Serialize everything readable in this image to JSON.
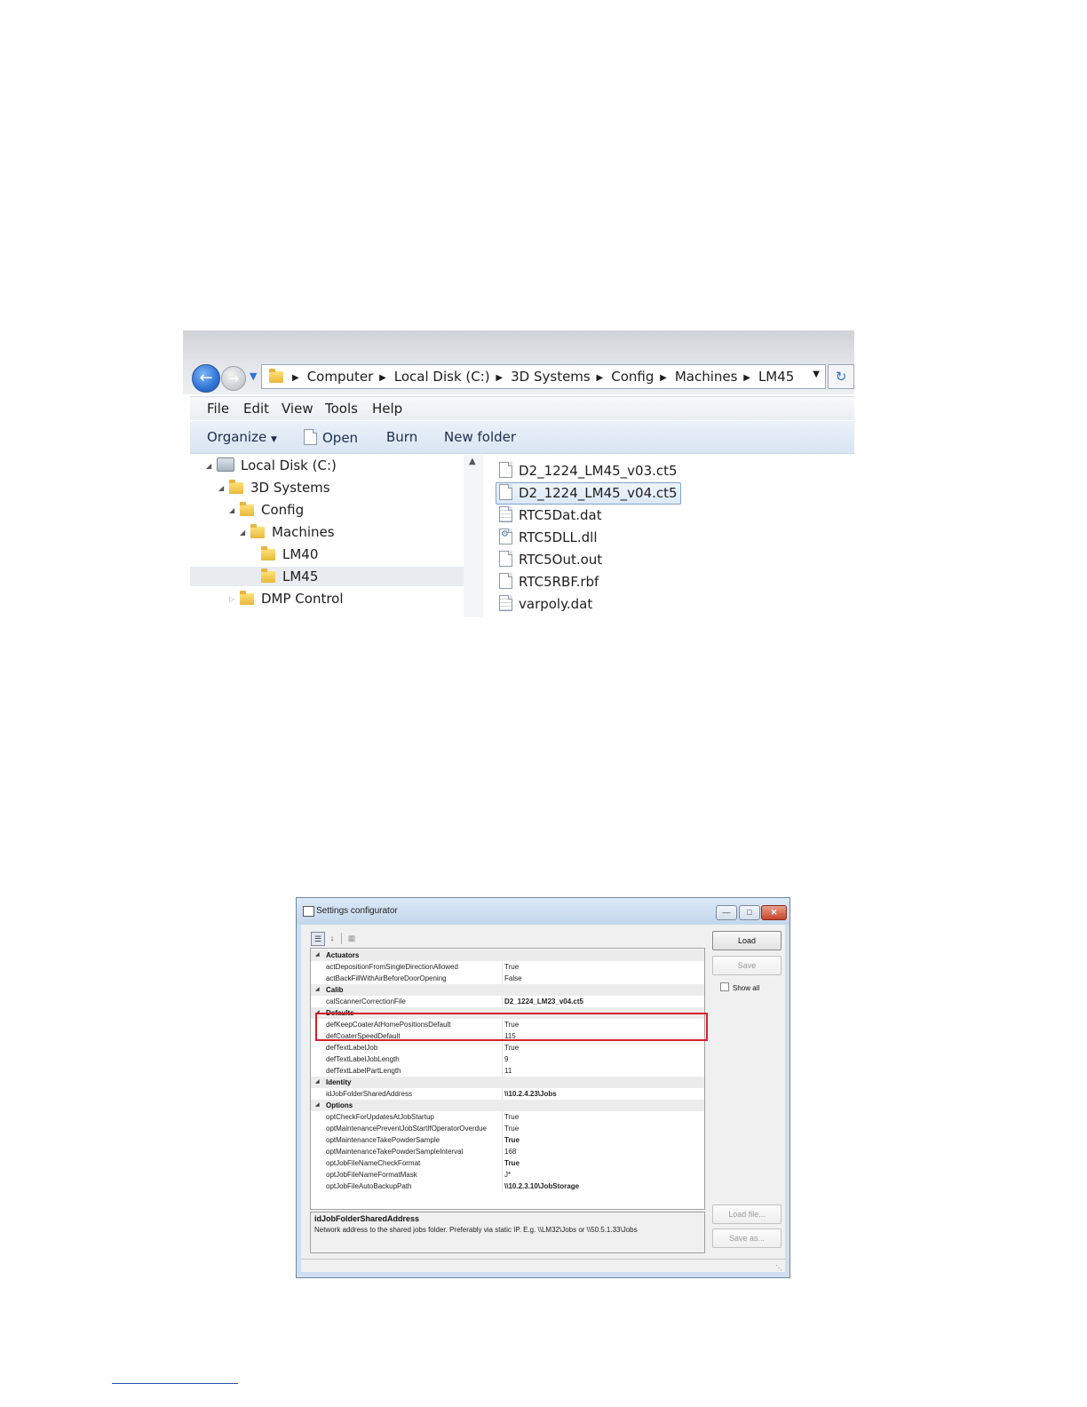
{
  "explorer": {
    "breadcrumbs": [
      "Computer",
      "Local Disk (C:)",
      "3D Systems",
      "Config",
      "Machines",
      "LM45"
    ],
    "menu": [
      "File",
      "Edit",
      "View",
      "Tools",
      "Help"
    ],
    "commands": {
      "organize": "Organize",
      "open": "Open",
      "burn": "Burn",
      "new_folder": "New folder"
    },
    "tree": [
      "Local Disk (C:)",
      "3D Systems",
      "Config",
      "Machines",
      "LM40",
      "LM45",
      "DMP Control"
    ],
    "files": [
      "D2_1224_LM45_v03.ct5",
      "D2_1224_LM45_v04.ct5",
      "RTC5Dat.dat",
      "RTC5DLL.dll",
      "RTC5Out.out",
      "RTC5RBF.rbf",
      "varpoly.dat"
    ],
    "selected_file": "D2_1224_LM45_v04.ct5",
    "selected_folder": "LM45"
  },
  "settings": {
    "title": "Settings configurator",
    "buttons": {
      "load": "Load",
      "save": "Save",
      "load_file": "Load file...",
      "save_as": "Save as..."
    },
    "show_all": "Show all",
    "grid": [
      {
        "cat": "Actuators"
      },
      {
        "name": "actDepositionFromSingleDirectionAllowed",
        "value": "True"
      },
      {
        "name": "actBackFillWithAirBeforeDoorOpening",
        "value": "False"
      },
      {
        "cat": "Calib"
      },
      {
        "name": "calScannerCorrectionFile",
        "value": "D2_1224_LM23_v04.ct5"
      },
      {
        "cat": "Defaults"
      },
      {
        "name": "defKeepCoaterAtHomePositionsDefault",
        "value": "True"
      },
      {
        "name": "defCoaterSpeedDefault",
        "value": "115"
      },
      {
        "name": "defTextLabelJob",
        "value": "True"
      },
      {
        "name": "defTextLabelJobLength",
        "value": "9"
      },
      {
        "name": "defTextLabelPartLength",
        "value": "11"
      },
      {
        "cat": "Identity"
      },
      {
        "name": "idJobFolderSharedAddress",
        "value": "\\\\10.2.4.23\\Jobs"
      },
      {
        "cat": "Options"
      },
      {
        "name": "optCheckForUpdatesAtJobStartup",
        "value": "True"
      },
      {
        "name": "optMaintenancePreventJobStartIfOperatorOverdue",
        "value": "True"
      },
      {
        "name": "optMaintenanceTakePowderSample",
        "value": "True"
      },
      {
        "name": "optMaintenanceTakePowderSampleInterval",
        "value": "168"
      },
      {
        "name": "optJobFileNameCheckFormat",
        "value": "True"
      },
      {
        "name": "optJobFileNameFormatMask",
        "value": "J*"
      },
      {
        "name": "optJobFileAutoBackupPath",
        "value": "\\\\10.2.3.10\\JobStorage"
      }
    ],
    "description": {
      "title": "idJobFolderSharedAddress",
      "text": "Network address to the shared jobs folder. Preferably via static IP. E.g. \\\\LM32\\Jobs or \\\\50.5.1.33\\Jobs"
    }
  },
  "colors": {
    "highlight_box": "#d9202a",
    "selection_blue": "#7da2ce"
  }
}
